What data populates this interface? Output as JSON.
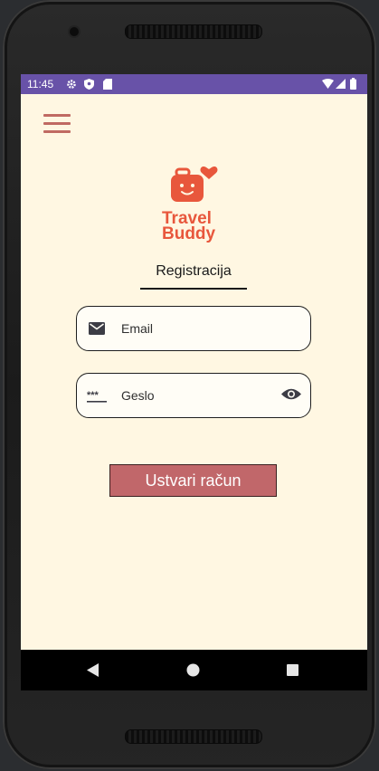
{
  "status_bar": {
    "time": "11:45",
    "icons": [
      "settings-gear-icon",
      "shield-icon",
      "sim-card-icon",
      "wifi-icon",
      "signal-icon",
      "battery-icon"
    ]
  },
  "app": {
    "logo": {
      "line1": "Travel",
      "line2": "Buddy"
    },
    "tab": {
      "label": "Registracija"
    },
    "email": {
      "placeholder": "Email",
      "value": ""
    },
    "password": {
      "placeholder": "Geslo",
      "value": ""
    },
    "submit_label": "Ustvari račun"
  },
  "nav_bar": {
    "buttons": [
      "back",
      "home",
      "recents"
    ]
  },
  "colors": {
    "status_bar": "#6852a8",
    "background": "#fff7e2",
    "accent": "#c1676a",
    "logo": "#e8573c"
  }
}
